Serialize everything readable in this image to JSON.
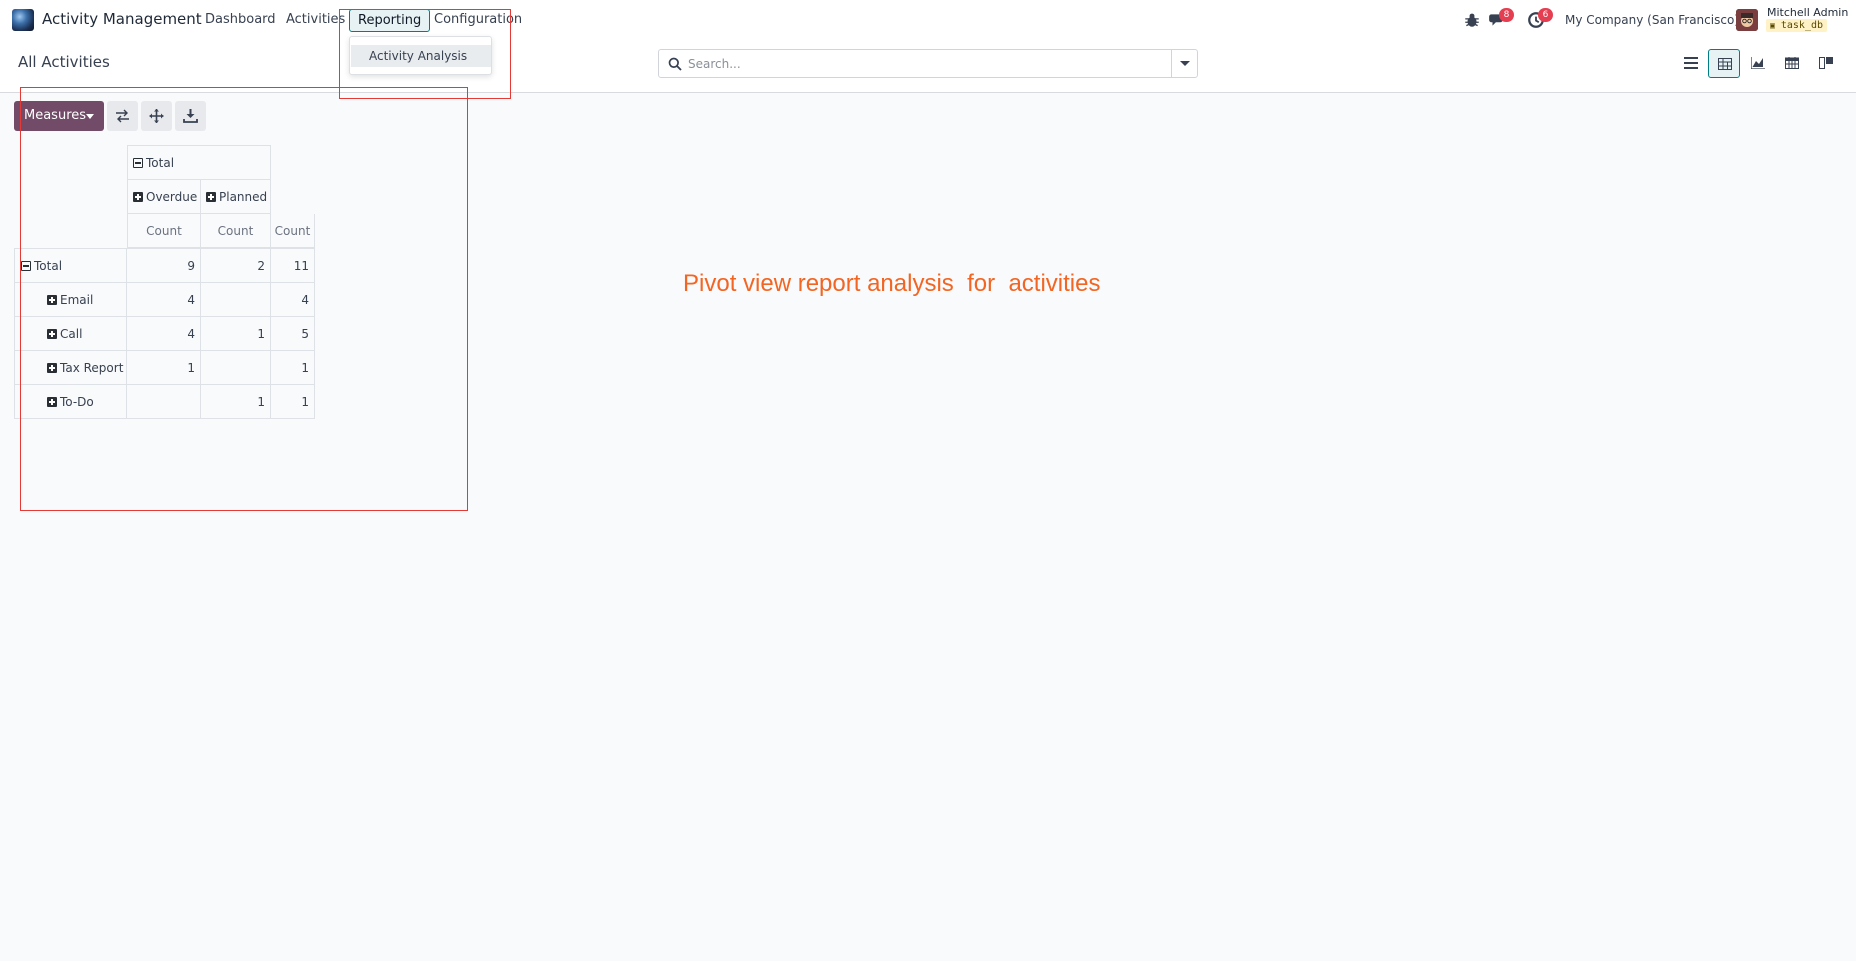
{
  "navbar": {
    "app_name": "Activity Management",
    "menu": [
      "Dashboard",
      "Activities",
      "Reporting",
      "Configuration"
    ],
    "active_menu": "Reporting",
    "badges": {
      "messages": "8",
      "activities": "6"
    },
    "company": "My Company (San Francisco)",
    "user_name": "Mitchell Admin",
    "database": "task_db"
  },
  "dropdown": {
    "items": [
      "Activity Analysis"
    ]
  },
  "control_panel": {
    "breadcrumb": "All Activities",
    "search_placeholder": "Search...",
    "views": [
      "list-view-icon",
      "pivot-view-icon",
      "graph-view-icon",
      "calendar-view-icon",
      "kanban-view-icon"
    ],
    "active_view": "pivot-view-icon"
  },
  "pivot": {
    "measures_label": "Measures",
    "col_total": "Total",
    "col_groups": [
      "Overdue",
      "Planned"
    ],
    "measure": "Count",
    "row_total": "Total",
    "totals": [
      "9",
      "2",
      "11"
    ],
    "rows": [
      {
        "label": "Email",
        "values": [
          "4",
          "",
          "4"
        ]
      },
      {
        "label": "Call",
        "values": [
          "4",
          "1",
          "5"
        ]
      },
      {
        "label": "Tax Report",
        "values": [
          "1",
          "",
          "1"
        ]
      },
      {
        "label": "To-Do",
        "values": [
          "",
          "1",
          "1"
        ]
      }
    ]
  },
  "annotation": {
    "text": "Pivot view report analysis  for  activities",
    "color": "#f26522",
    "box_color": "#e53935"
  }
}
